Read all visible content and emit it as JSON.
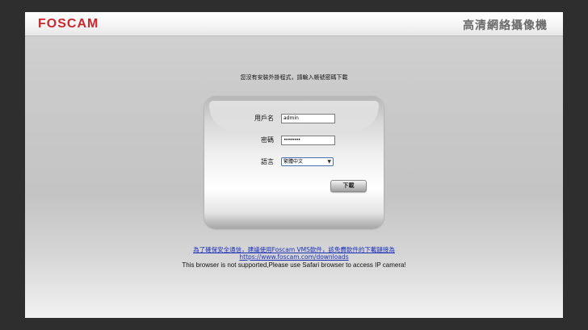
{
  "header": {
    "logo": "FOSCAM",
    "title": "高清網絡攝像機"
  },
  "notice": "您沒有安裝外掛程式，請輸入帳號密碼下載",
  "login": {
    "username_label": "用戶名",
    "username_value": "admin",
    "password_label": "密碼",
    "password_value": "••••••••",
    "language_label": "語言",
    "language_selected": "繁體中文",
    "download_button": "下載"
  },
  "footer": {
    "vms_link": "為了確保安全通信，建議使用Foscam VMS軟件，該免費軟件的下載鏈接為",
    "download_url": "https://www.foscam.com/downloads",
    "browser_warning": "This browser is not supported,Please use Safari browser to access IP camera!"
  },
  "colors": {
    "brand": "#c8282d",
    "link": "#1a2fb8"
  }
}
